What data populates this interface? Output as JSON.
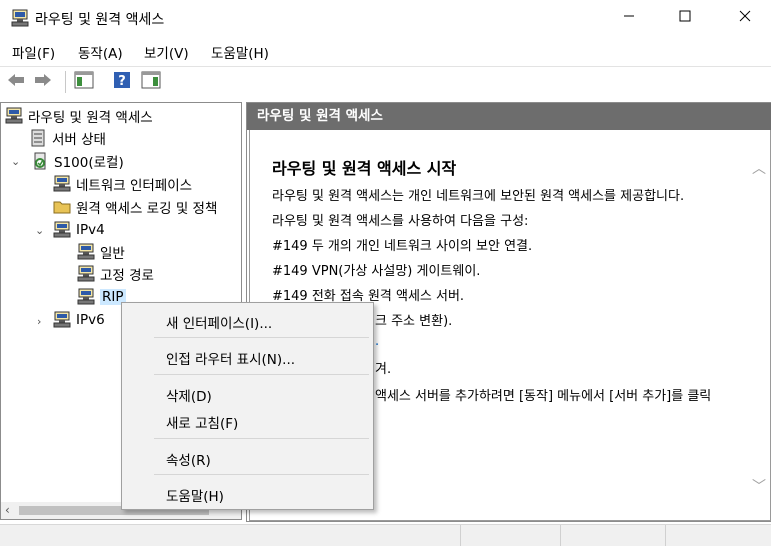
{
  "window": {
    "title": "라우팅 및 원격 액세스",
    "icons": [
      "server-icon",
      "minimize-icon",
      "maximize-icon",
      "close-icon"
    ]
  },
  "menu": {
    "file": "파일(F)",
    "action": "동작(A)",
    "view": "보기(V)",
    "help": "도움말(H)"
  },
  "toolbar": {
    "icons": [
      "back-arrow-icon",
      "forward-arrow-icon",
      "show-hide-tree-icon",
      "help-icon",
      "action-pane-icon"
    ]
  },
  "tree": {
    "root": "라우팅 및 원격 액세스",
    "server_status": "서버 상태",
    "server": "S100(로컬)",
    "network_interfaces": "네트워크 인터페이스",
    "remote_access_logging": "원격 액세스 로깅 및 정책",
    "ipv4": "IPv4",
    "general": "일반",
    "static_routes": "고정 경로",
    "rip": "RIP",
    "ipv6": "IPv6"
  },
  "right": {
    "header": "라우팅 및 원격 액세스",
    "title": "라우팅 및 원격 액세스 시작",
    "lines": [
      "라우팅 및 원격 액세스는 개인 네트워크에 보안된 원격 액세스를 제공합니다.",
      "라우팅 및 원격 액세스를 사용하여 다음을 구성:",
      "#149 두 개의 개인 네트워크 사이의 보안 연결.",
      "#149 VPN(가상 사설망) 게이트웨이.",
      "#149 전화 접속 원격 액세스 서버.",
      "크 주소 변환).",
      ".",
      "겨.",
      "액세스 서버를 추가하려면 [동작] 메뉴에서 [서버 추가]를 클릭"
    ]
  },
  "context_menu": {
    "new_interface": "새 인터페이스(I)...",
    "show_neighbors": "인접 라우터 표시(N)...",
    "delete": "삭제(D)",
    "refresh": "새로 고침(F)",
    "properties": "속성(R)",
    "help": "도움말(H)"
  },
  "colors": {
    "header_bg": "#6d6d6d",
    "selection": "#cce8ff",
    "link_blue": "#0066cc"
  }
}
